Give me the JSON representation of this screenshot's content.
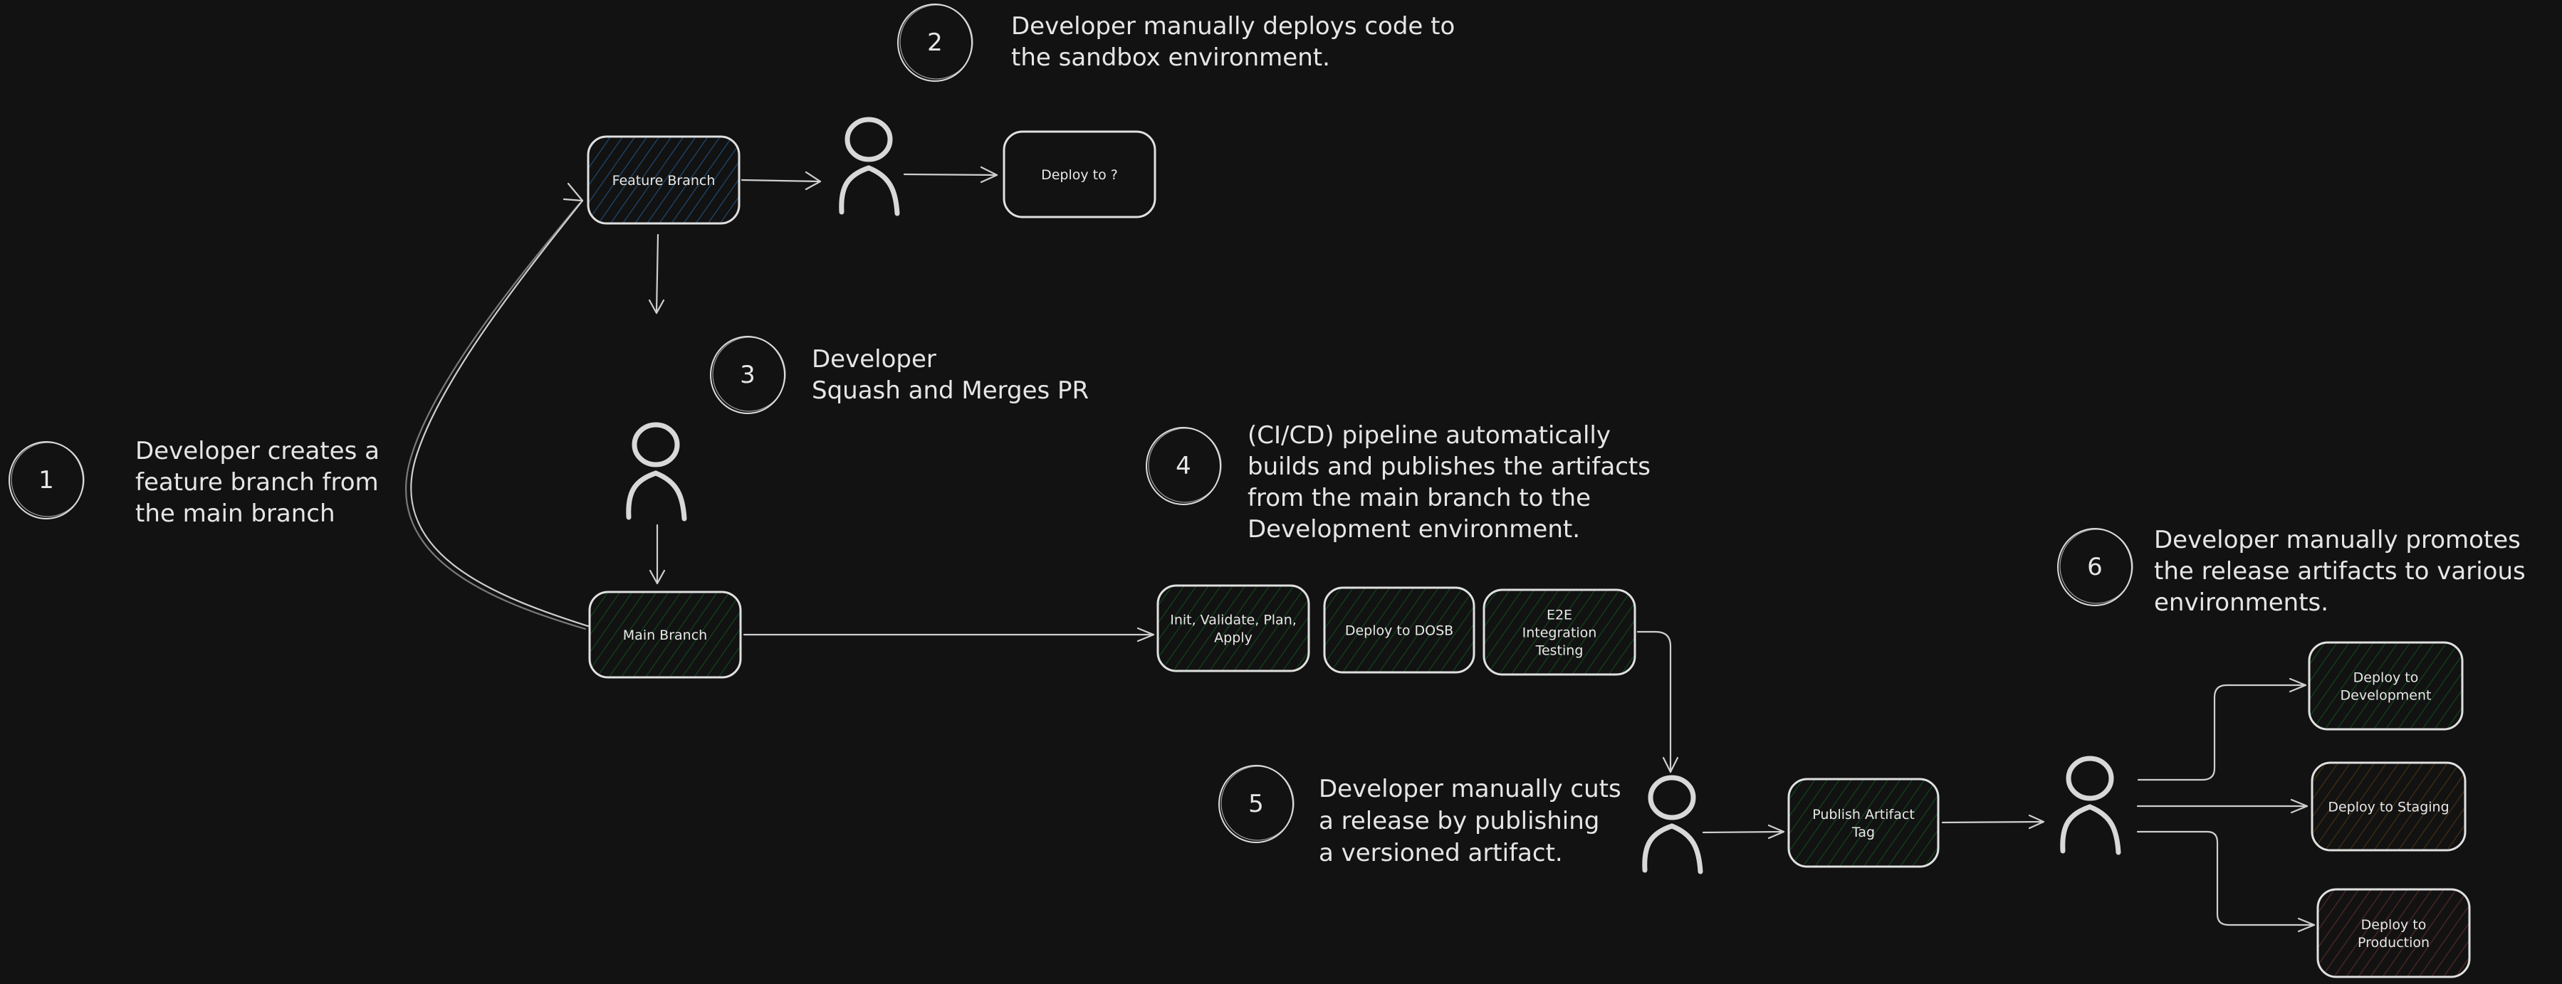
{
  "colors": {
    "background": "#121212",
    "stroke": "#dcdcdc",
    "hatch_blue": "#1f4f7a",
    "hatch_green": "#0f4a1a",
    "hatch_orange": "#4a3210",
    "hatch_red": "#5a2a28"
  },
  "steps": [
    {
      "number": "1",
      "lines": [
        "Developer creates a",
        "feature branch from",
        "the main branch"
      ]
    },
    {
      "number": "2",
      "lines": [
        "Developer manually deploys code to",
        "the sandbox environment."
      ]
    },
    {
      "number": "3",
      "lines": [
        "Developer",
        "Squash and Merges PR"
      ]
    },
    {
      "number": "4",
      "lines": [
        "(CI/CD) pipeline automatically",
        "builds and publishes the artifacts",
        "from the main branch to the",
        "Development environment."
      ]
    },
    {
      "number": "5",
      "lines": [
        "Developer manually cuts",
        "a release by publishing",
        "a versioned artifact."
      ]
    },
    {
      "number": "6",
      "lines": [
        "Developer manually promotes",
        "the release artifacts to various",
        "environments."
      ]
    }
  ],
  "nodes": {
    "feature_branch": {
      "lines": [
        "Feature Branch"
      ],
      "hatch": "blue"
    },
    "deploy_unknown": {
      "lines": [
        "Deploy to ?"
      ],
      "hatch": "none"
    },
    "main_branch": {
      "lines": [
        "Main Branch"
      ],
      "hatch": "green"
    },
    "init_validate": {
      "lines": [
        "Init, Validate, Plan,",
        "Apply"
      ],
      "hatch": "green"
    },
    "deploy_dosb": {
      "lines": [
        "Deploy to DOSB"
      ],
      "hatch": "green"
    },
    "e2e_testing": {
      "lines": [
        "E2E",
        "Integration",
        "Testing"
      ],
      "hatch": "green"
    },
    "publish_tag": {
      "lines": [
        "Publish Artifact",
        "Tag"
      ],
      "hatch": "green"
    },
    "deploy_development": {
      "lines": [
        "Deploy to",
        "Development"
      ],
      "hatch": "green"
    },
    "deploy_staging": {
      "lines": [
        "Deploy to Staging"
      ],
      "hatch": "orange"
    },
    "deploy_production": {
      "lines": [
        "Deploy to",
        "Production"
      ],
      "hatch": "red"
    }
  },
  "actors": [
    {
      "id": "developer-sandbox",
      "role": "Developer"
    },
    {
      "id": "developer-merge",
      "role": "Developer"
    },
    {
      "id": "developer-release",
      "role": "Developer"
    },
    {
      "id": "developer-promote",
      "role": "Developer"
    }
  ]
}
